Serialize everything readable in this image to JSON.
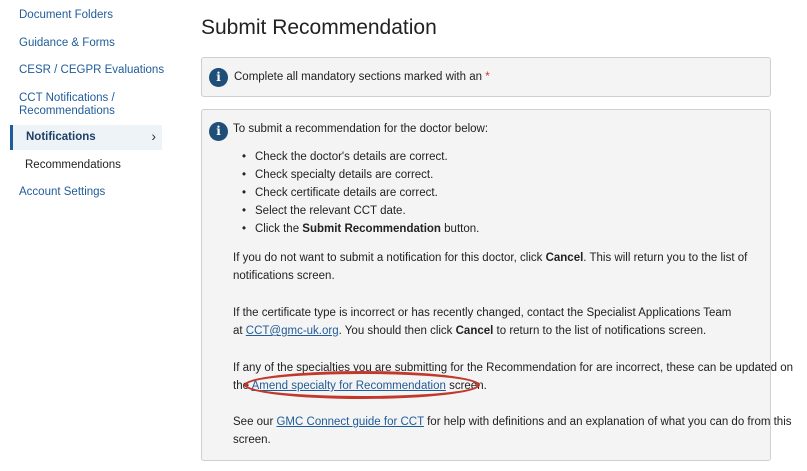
{
  "sidebar": {
    "document_folders": "Document Folders",
    "guidance_forms": "Guidance & Forms",
    "cesr_cegpr": "CESR / CEGPR Evaluations",
    "cct_line1": "CCT Notifications /",
    "cct_line2": "Recommendations",
    "notifications": "Notifications",
    "chevron": "›",
    "recommendations": "Recommendations",
    "account_settings": "Account Settings"
  },
  "page": {
    "title": "Submit Recommendation",
    "mandatory_text": "Complete all mandatory sections marked with an",
    "mandatory_star": "*",
    "intro": "To submit a recommendation for the doctor below:",
    "bullets": [
      "Check the doctor's details are correct.",
      "Check specialty details are correct.",
      "Check certificate details are correct.",
      "Select the relevant CCT date."
    ],
    "bullet5_pre": "Click the ",
    "bullet5_bold": "Submit Recommendation",
    "bullet5_post": " button.",
    "p1_pre": "If you do not want to submit a notification for this doctor, click ",
    "p1_bold": "Cancel",
    "p1_post1": ". This will return you to the list of",
    "p1_post2": "notifications screen.",
    "p2_line1": "If the certificate type is incorrect or has recently changed, contact the Specialist Applications Team",
    "p2_at": "at ",
    "p2_email": "CCT@gmc-uk.org",
    "p2_mid": ". You should then click ",
    "p2_bold": "Cancel",
    "p2_post": " to return to the list of notifications screen.",
    "p3_line1": "If any of the specialties you are submitting for the Recommendation for are incorrect, these can be updated on",
    "p3_pre": "the ",
    "p3_link": "Amend specialty for Recommendation",
    "p3_post": " screen.",
    "p4_pre": "See our ",
    "p4_link": "GMC Connect guide for CCT",
    "p4_post": " for help with definitions and an explanation of what you can do from this",
    "p4_line2": "screen."
  },
  "colors": {
    "link": "#1f5c99",
    "icon": "#1f4e79",
    "highlight": "#c0392b",
    "star": "#d0342c"
  }
}
